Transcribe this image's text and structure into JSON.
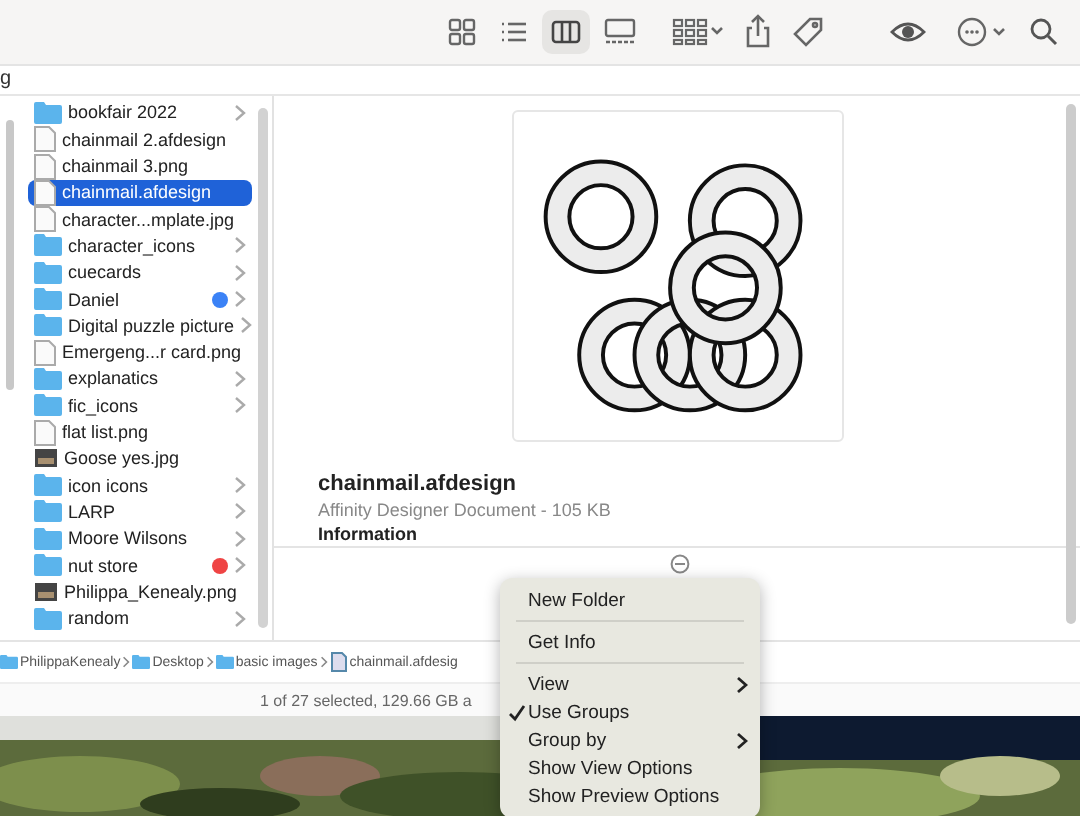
{
  "toolbar": [
    {
      "kind": "grid",
      "selected": false
    },
    {
      "kind": "list",
      "selected": false
    },
    {
      "kind": "columns",
      "selected": true
    },
    {
      "kind": "gallery",
      "selected": false
    },
    {
      "kind": "group",
      "selected": false
    },
    {
      "kind": "share",
      "selected": false
    },
    {
      "kind": "tag",
      "selected": false
    },
    {
      "kind": "eye",
      "selected": false
    },
    {
      "kind": "more",
      "selected": false
    },
    {
      "kind": "search",
      "selected": false
    }
  ],
  "location_fragment": "g",
  "files": [
    {
      "name": "bookfair 2022",
      "kind": "folder",
      "selected": false
    },
    {
      "name": "chainmail 2.afdesign",
      "kind": "file",
      "selected": false
    },
    {
      "name": "chainmail 3.png",
      "kind": "file",
      "selected": false
    },
    {
      "name": "chainmail.afdesign",
      "kind": "file",
      "selected": true
    },
    {
      "name": "character...mplate.jpg",
      "kind": "file",
      "selected": false
    },
    {
      "name": "character_icons",
      "kind": "folder",
      "selected": false
    },
    {
      "name": "cuecards",
      "kind": "folder",
      "selected": false
    },
    {
      "name": "Daniel",
      "kind": "folder",
      "selected": false,
      "color": "#3b82f6"
    },
    {
      "name": "Digital puzzle picture",
      "kind": "folder",
      "selected": false
    },
    {
      "name": "Emergeng...r card.png",
      "kind": "file",
      "selected": false
    },
    {
      "name": "explanatics",
      "kind": "folder",
      "selected": false
    },
    {
      "name": "fic_icons",
      "kind": "folder",
      "selected": false
    },
    {
      "name": "flat list.png",
      "kind": "file",
      "selected": false
    },
    {
      "name": "Goose yes.jpg",
      "selected": false
    },
    {
      "name": "icon icons",
      "kind": "folder",
      "selected": false
    },
    {
      "name": "LARP",
      "kind": "folder",
      "selected": false
    },
    {
      "name": "Moore Wilsons",
      "kind": "folder",
      "selected": false
    },
    {
      "name": "nut store",
      "kind": "folder",
      "selected": false,
      "color": "#ef4444"
    },
    {
      "name": "Philippa_Kenealy.png",
      "selected": false
    },
    {
      "name": "random",
      "kind": "folder",
      "selected": false
    }
  ],
  "preview": {
    "name": "chainmail.afdesign",
    "subtitle": "Affinity Designer Document - 105 KB",
    "section": "Information"
  },
  "path_bar": [
    {
      "name": "PhilippaKenealy",
      "kind": "folder"
    },
    {
      "name": "Desktop",
      "kind": "folder"
    },
    {
      "name": "basic images",
      "kind": "folder"
    },
    {
      "name": "chainmail.afdesig",
      "kind": "file"
    }
  ],
  "status": "1 of 27 selected, 129.66 GB a",
  "context_menu": [
    [
      {
        "label": "New Folder",
        "checked": false,
        "submenu": false
      }
    ],
    [
      {
        "label": "Get Info",
        "checked": false,
        "submenu": false
      }
    ],
    [
      {
        "label": "View",
        "checked": false,
        "submenu": true
      },
      {
        "label": "Use Groups",
        "checked": true,
        "submenu": false
      },
      {
        "label": "Group by",
        "checked": false,
        "submenu": true
      },
      {
        "label": "Show View Options",
        "checked": false,
        "submenu": false
      },
      {
        "label": "Show Preview Options",
        "checked": false,
        "submenu": false
      }
    ]
  ]
}
